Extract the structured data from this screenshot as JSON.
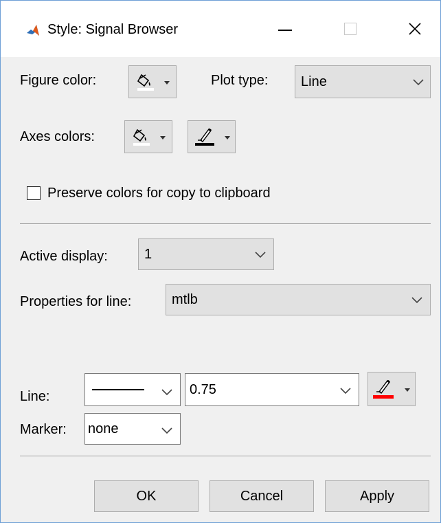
{
  "window": {
    "title": "Style: Signal Browser"
  },
  "figure": {
    "color_label": "Figure color:",
    "plot_type_label": "Plot type:",
    "plot_type_value": "Line"
  },
  "axes": {
    "colors_label": "Axes colors:"
  },
  "preserve_colors": {
    "label": "Preserve colors for copy to clipboard",
    "checked": false
  },
  "active_display": {
    "label": "Active display:",
    "value": "1"
  },
  "properties": {
    "label": "Properties for line:",
    "value": "mtlb"
  },
  "line": {
    "label": "Line:",
    "width_value": "0.75",
    "color": "#ff0000"
  },
  "marker": {
    "label": "Marker:",
    "value": "none"
  },
  "buttons": {
    "ok": "OK",
    "cancel": "Cancel",
    "apply": "Apply"
  },
  "colors": {
    "accent_border": "#6d9fd6",
    "face": "#f0f0f0"
  }
}
